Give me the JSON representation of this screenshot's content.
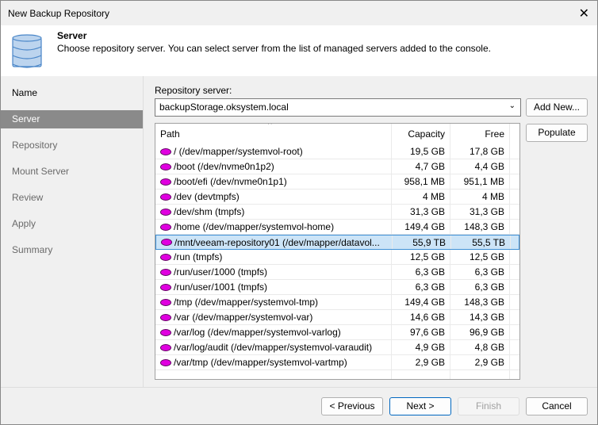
{
  "window": {
    "title": "New Backup Repository",
    "close": "✕"
  },
  "header": {
    "title": "Server",
    "description": "Choose repository server. You can select server from the list of managed servers added to the console."
  },
  "steps": [
    "Name",
    "Server",
    "Repository",
    "Mount Server",
    "Review",
    "Apply",
    "Summary"
  ],
  "repo_server": {
    "label": "Repository server:",
    "value": "backupStorage.oksystem.local",
    "add_new": "Add New...",
    "populate": "Populate"
  },
  "table": {
    "columns": [
      "Path",
      "Capacity",
      "Free"
    ],
    "rows": [
      [
        "/ (/dev/mapper/systemvol-root)",
        "19,5 GB",
        "17,8 GB"
      ],
      [
        "/boot (/dev/nvme0n1p2)",
        "4,7 GB",
        "4,4 GB"
      ],
      [
        "/boot/efi (/dev/nvme0n1p1)",
        "958,1 MB",
        "951,1 MB"
      ],
      [
        "/dev (devtmpfs)",
        "4 MB",
        "4 MB"
      ],
      [
        "/dev/shm (tmpfs)",
        "31,3 GB",
        "31,3 GB"
      ],
      [
        "/home (/dev/mapper/systemvol-home)",
        "149,4 GB",
        "148,3 GB"
      ],
      [
        "/mnt/veeam-repository01 (/dev/mapper/datavol...",
        "55,9 TB",
        "55,5 TB"
      ],
      [
        "/run (tmpfs)",
        "12,5 GB",
        "12,5 GB"
      ],
      [
        "/run/user/1000 (tmpfs)",
        "6,3 GB",
        "6,3 GB"
      ],
      [
        "/run/user/1001 (tmpfs)",
        "6,3 GB",
        "6,3 GB"
      ],
      [
        "/tmp (/dev/mapper/systemvol-tmp)",
        "149,4 GB",
        "148,3 GB"
      ],
      [
        "/var (/dev/mapper/systemvol-var)",
        "14,6 GB",
        "14,3 GB"
      ],
      [
        "/var/log (/dev/mapper/systemvol-varlog)",
        "97,6 GB",
        "96,9 GB"
      ],
      [
        "/var/log/audit (/dev/mapper/systemvol-varaudit)",
        "4,9 GB",
        "4,8 GB"
      ],
      [
        "/var/tmp (/dev/mapper/systemvol-vartmp)",
        "2,9 GB",
        "2,9 GB"
      ]
    ],
    "selected_index": 6
  },
  "footer": {
    "previous": "< Previous",
    "next": "Next >",
    "finish": "Finish",
    "cancel": "Cancel"
  }
}
